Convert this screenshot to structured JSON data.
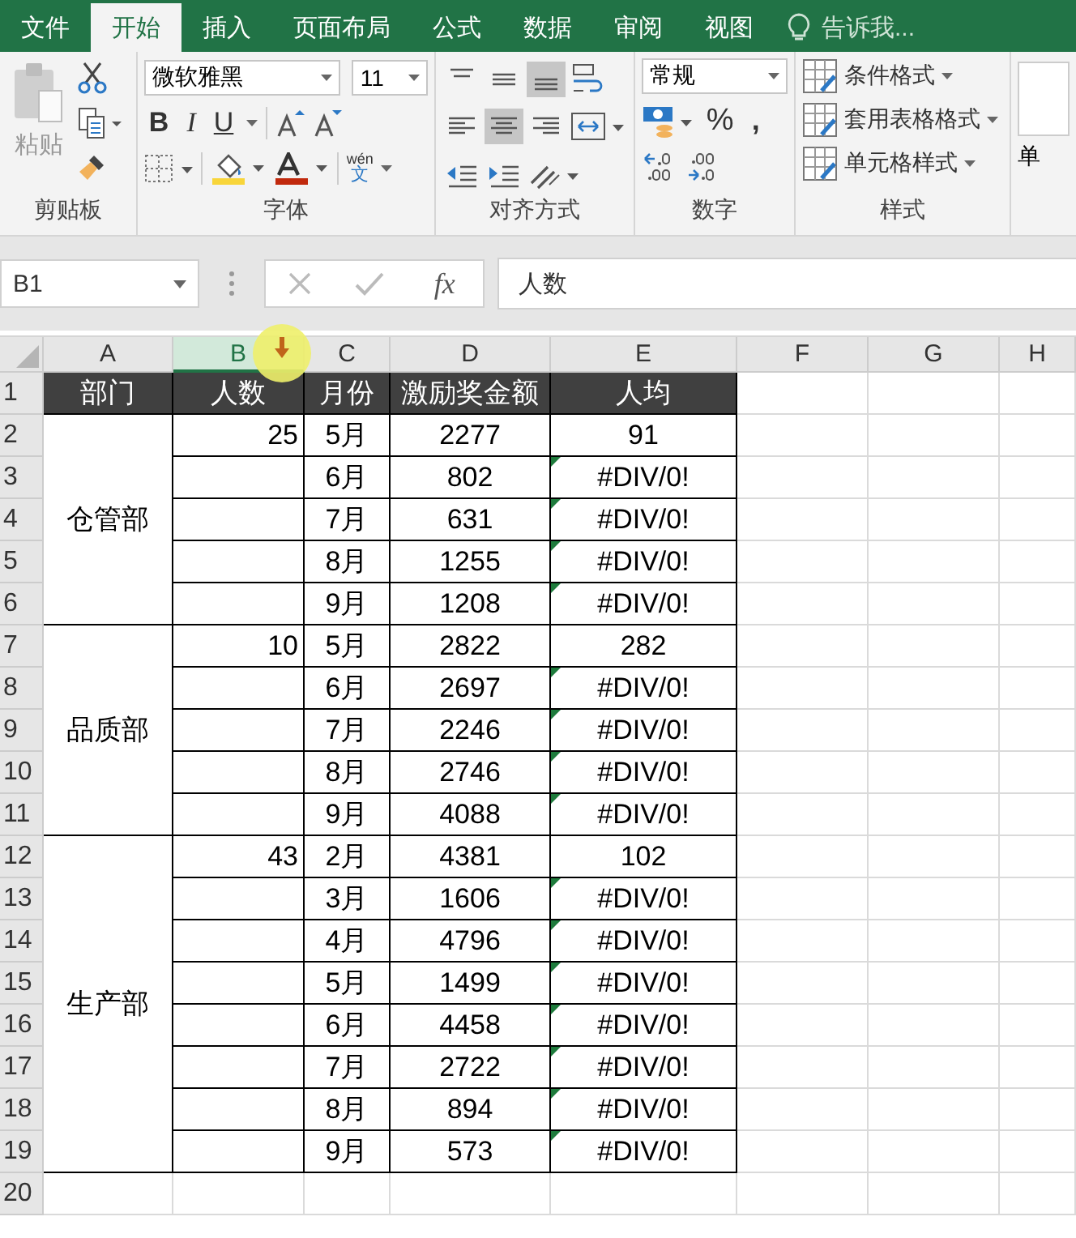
{
  "tabs": [
    {
      "label": "文件",
      "selected": false
    },
    {
      "label": "开始",
      "selected": true
    },
    {
      "label": "插入",
      "selected": false
    },
    {
      "label": "页面布局",
      "selected": false
    },
    {
      "label": "公式",
      "selected": false
    },
    {
      "label": "数据",
      "selected": false
    },
    {
      "label": "审阅",
      "selected": false
    },
    {
      "label": "视图",
      "selected": false
    }
  ],
  "tell_me": {
    "placeholder": "告诉我..."
  },
  "ribbon": {
    "clipboard": {
      "paste": "粘贴",
      "label": "剪贴板"
    },
    "font": {
      "name": "微软雅黑",
      "size": "11",
      "bold": "B",
      "italic": "I",
      "underline": "U",
      "phonetic_top": "wén",
      "phonetic_bottom": "文",
      "label": "字体"
    },
    "alignment": {
      "label": "对齐方式"
    },
    "number": {
      "format": "常规",
      "percent": "%",
      "comma": ",",
      "label": "数字"
    },
    "styles": {
      "items": [
        "条件格式",
        "套用表格格式",
        "单元格样式"
      ],
      "label": "样式"
    },
    "cells": {
      "label": "单"
    }
  },
  "formula_bar": {
    "name_box": "B1",
    "function_label": "fx",
    "value": "人数"
  },
  "sheet": {
    "columns": [
      {
        "label": "A",
        "selected": false
      },
      {
        "label": "B",
        "selected": true
      },
      {
        "label": "C",
        "selected": false
      },
      {
        "label": "D",
        "selected": false
      },
      {
        "label": "E",
        "selected": false
      },
      {
        "label": "F",
        "selected": false
      },
      {
        "label": "G",
        "selected": false
      },
      {
        "label": "H",
        "selected": false
      }
    ],
    "row_numbers": [
      "1",
      "2",
      "3",
      "4",
      "5",
      "6",
      "7",
      "8",
      "9",
      "10",
      "11",
      "12",
      "13",
      "14",
      "15",
      "16",
      "17",
      "18",
      "19",
      "20"
    ],
    "header": [
      "部门",
      "人数",
      "月份",
      "激励奖金额",
      "人均"
    ],
    "groups": [
      {
        "department": "仓管部",
        "headcount": "25",
        "rows": [
          {
            "month": "5月",
            "amount": "2277",
            "average": "91",
            "flagged": false
          },
          {
            "month": "6月",
            "amount": "802",
            "average": "#DIV/0!",
            "flagged": true
          },
          {
            "month": "7月",
            "amount": "631",
            "average": "#DIV/0!",
            "flagged": true
          },
          {
            "month": "8月",
            "amount": "1255",
            "average": "#DIV/0!",
            "flagged": true
          },
          {
            "month": "9月",
            "amount": "1208",
            "average": "#DIV/0!",
            "flagged": true
          }
        ]
      },
      {
        "department": "品质部",
        "headcount": "10",
        "rows": [
          {
            "month": "5月",
            "amount": "2822",
            "average": "282",
            "flagged": false
          },
          {
            "month": "6月",
            "amount": "2697",
            "average": "#DIV/0!",
            "flagged": true
          },
          {
            "month": "7月",
            "amount": "2246",
            "average": "#DIV/0!",
            "flagged": true
          },
          {
            "month": "8月",
            "amount": "2746",
            "average": "#DIV/0!",
            "flagged": true
          },
          {
            "month": "9月",
            "amount": "4088",
            "average": "#DIV/0!",
            "flagged": true
          }
        ]
      },
      {
        "department": "生产部",
        "headcount": "43",
        "rows": [
          {
            "month": "2月",
            "amount": "4381",
            "average": "102",
            "flagged": false
          },
          {
            "month": "3月",
            "amount": "1606",
            "average": "#DIV/0!",
            "flagged": true
          },
          {
            "month": "4月",
            "amount": "4796",
            "average": "#DIV/0!",
            "flagged": true
          },
          {
            "month": "5月",
            "amount": "1499",
            "average": "#DIV/0!",
            "flagged": true
          },
          {
            "month": "6月",
            "amount": "4458",
            "average": "#DIV/0!",
            "flagged": true
          },
          {
            "month": "7月",
            "amount": "2722",
            "average": "#DIV/0!",
            "flagged": true
          },
          {
            "month": "8月",
            "amount": "894",
            "average": "#DIV/0!",
            "flagged": true
          },
          {
            "month": "9月",
            "amount": "573",
            "average": "#DIV/0!",
            "flagged": true
          }
        ]
      }
    ]
  }
}
